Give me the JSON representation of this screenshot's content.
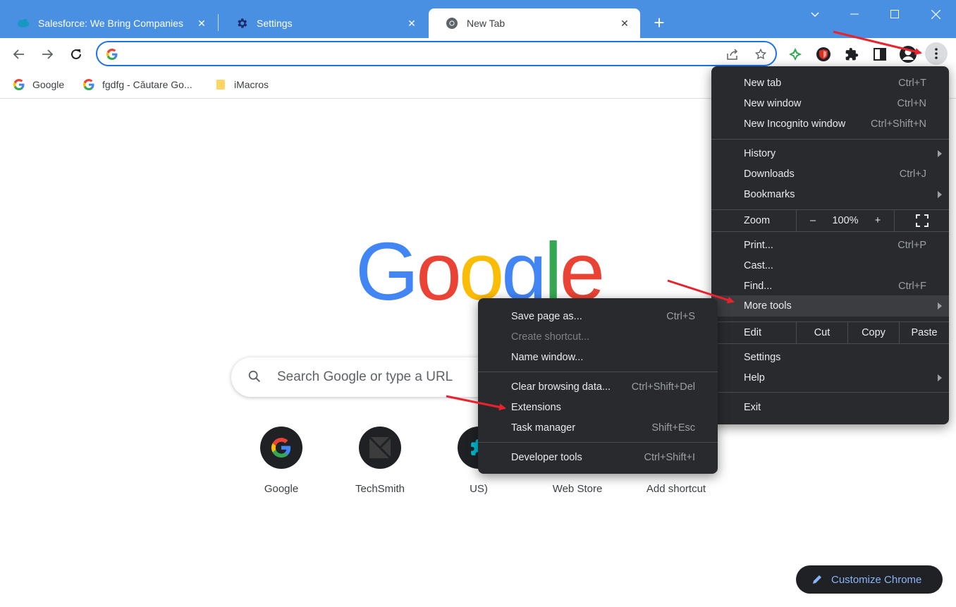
{
  "tabs": [
    {
      "label": "Salesforce: We Bring Companies",
      "favicon": "salesforce-cloud-icon"
    },
    {
      "label": "Settings",
      "favicon": "gear-icon"
    },
    {
      "label": "New Tab",
      "favicon": "chrome-icon"
    }
  ],
  "omnibox": {
    "value": "",
    "placeholder": ""
  },
  "bookmarks": [
    {
      "label": "Google",
      "icon": "google-g-icon"
    },
    {
      "label": "fgdfg - Căutare Go...",
      "icon": "google-g-icon"
    },
    {
      "label": "iMacros",
      "icon": "folder-icon"
    }
  ],
  "logo": {
    "letters": [
      "G",
      "o",
      "o",
      "g",
      "l",
      "e"
    ],
    "colors": [
      "#4285f4",
      "#ea4335",
      "#fbbc05",
      "#4285f4",
      "#34a853",
      "#ea4335"
    ]
  },
  "search": {
    "placeholder": "Search Google or type a URL"
  },
  "shortcuts": [
    {
      "label": "Google"
    },
    {
      "label": "TechSmith"
    },
    {
      "label": "US)"
    },
    {
      "label": "Web Store"
    },
    {
      "label": "Add shortcut"
    }
  ],
  "customize_label": "Customize Chrome",
  "menu": {
    "new_tab": {
      "label": "New tab",
      "shortcut": "Ctrl+T"
    },
    "new_window": {
      "label": "New window",
      "shortcut": "Ctrl+N"
    },
    "new_incognito": {
      "label": "New Incognito window",
      "shortcut": "Ctrl+Shift+N"
    },
    "history": {
      "label": "History"
    },
    "downloads": {
      "label": "Downloads",
      "shortcut": "Ctrl+J"
    },
    "bookmarks": {
      "label": "Bookmarks"
    },
    "zoom": {
      "label": "Zoom",
      "minus": "–",
      "value": "100%",
      "plus": "+"
    },
    "print": {
      "label": "Print...",
      "shortcut": "Ctrl+P"
    },
    "cast": {
      "label": "Cast..."
    },
    "find": {
      "label": "Find...",
      "shortcut": "Ctrl+F"
    },
    "more_tools": {
      "label": "More tools"
    },
    "edit": {
      "label": "Edit",
      "cut": "Cut",
      "copy": "Copy",
      "paste": "Paste"
    },
    "settings": {
      "label": "Settings"
    },
    "help": {
      "label": "Help"
    },
    "exit": {
      "label": "Exit"
    }
  },
  "submenu": {
    "save_page": {
      "label": "Save page as...",
      "shortcut": "Ctrl+S"
    },
    "create_shortcut": {
      "label": "Create shortcut..."
    },
    "name_window": {
      "label": "Name window..."
    },
    "clear_data": {
      "label": "Clear browsing data...",
      "shortcut": "Ctrl+Shift+Del"
    },
    "extensions": {
      "label": "Extensions"
    },
    "task_manager": {
      "label": "Task manager",
      "shortcut": "Shift+Esc"
    },
    "developer_tools": {
      "label": "Developer tools",
      "shortcut": "Ctrl+Shift+I"
    }
  },
  "colors": {
    "titlebar": "#4a90e2",
    "menu_bg": "#292a2d",
    "accent": "#1a73e8",
    "annotation_arrow": "#e8232b"
  }
}
